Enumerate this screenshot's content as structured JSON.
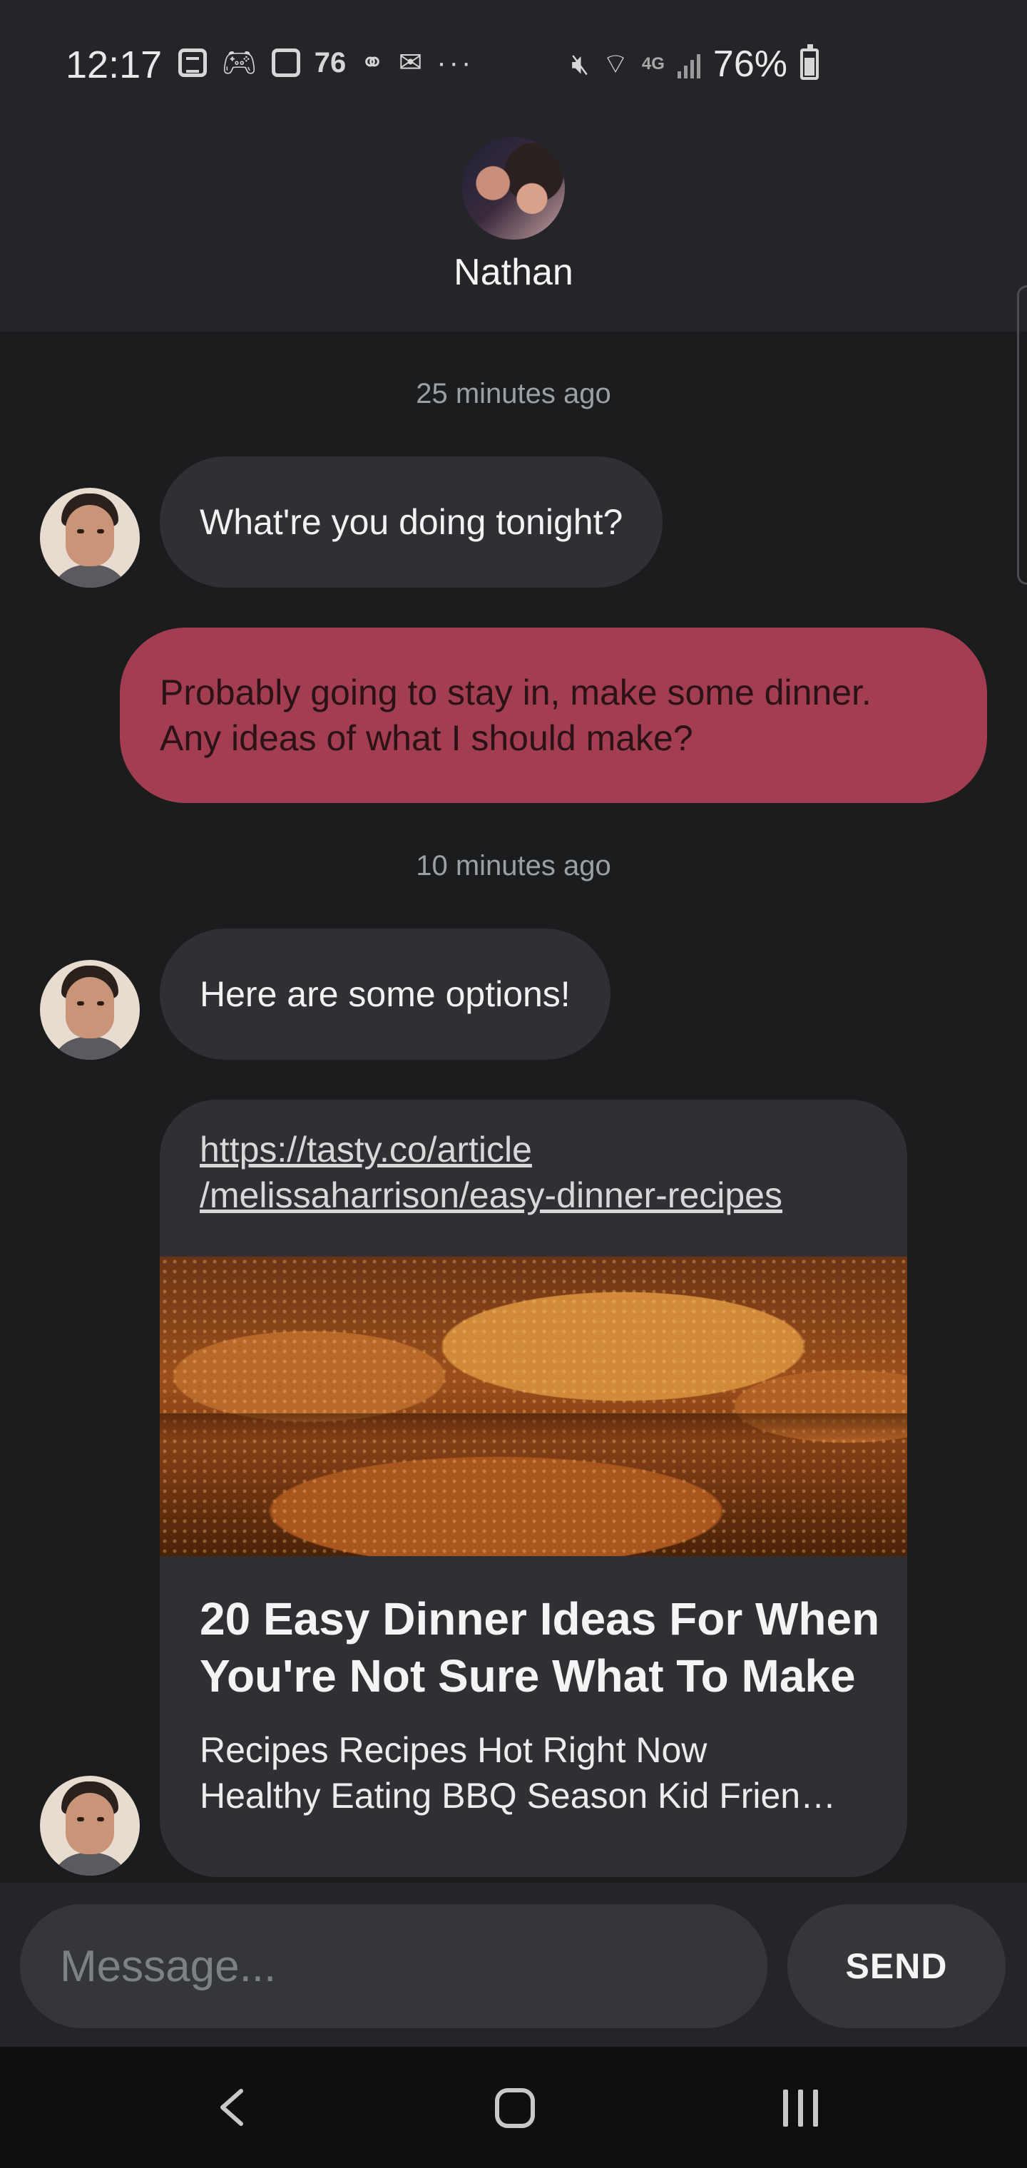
{
  "status_bar": {
    "time": "12:17",
    "notification_count": "76",
    "more": "···",
    "network": "4G",
    "battery": "76%"
  },
  "contact": {
    "name": "Nathan"
  },
  "messages": {
    "ts1": "25 minutes ago",
    "msg1": "What're you doing tonight?",
    "msg2": "Probably going to stay in, make some dinner.\nAny ideas of what I should make?",
    "ts2": "10 minutes ago",
    "msg3": "Here are some options!",
    "link": {
      "url": "https://tasty.co/article\n/melissaharrison/easy-dinner-recipes",
      "title": "20 Easy Dinner Ideas For When\nYou're Not Sure What To Make",
      "description": "Recipes Recipes Hot Right Now\nHealthy Eating BBQ Season Kid Frien…"
    }
  },
  "composer": {
    "placeholder": "Message...",
    "send_label": "SEND"
  },
  "colors": {
    "outgoing_bubble": "#a33d52",
    "incoming_bubble": "#2e3034",
    "background": "#1b1c1e"
  }
}
